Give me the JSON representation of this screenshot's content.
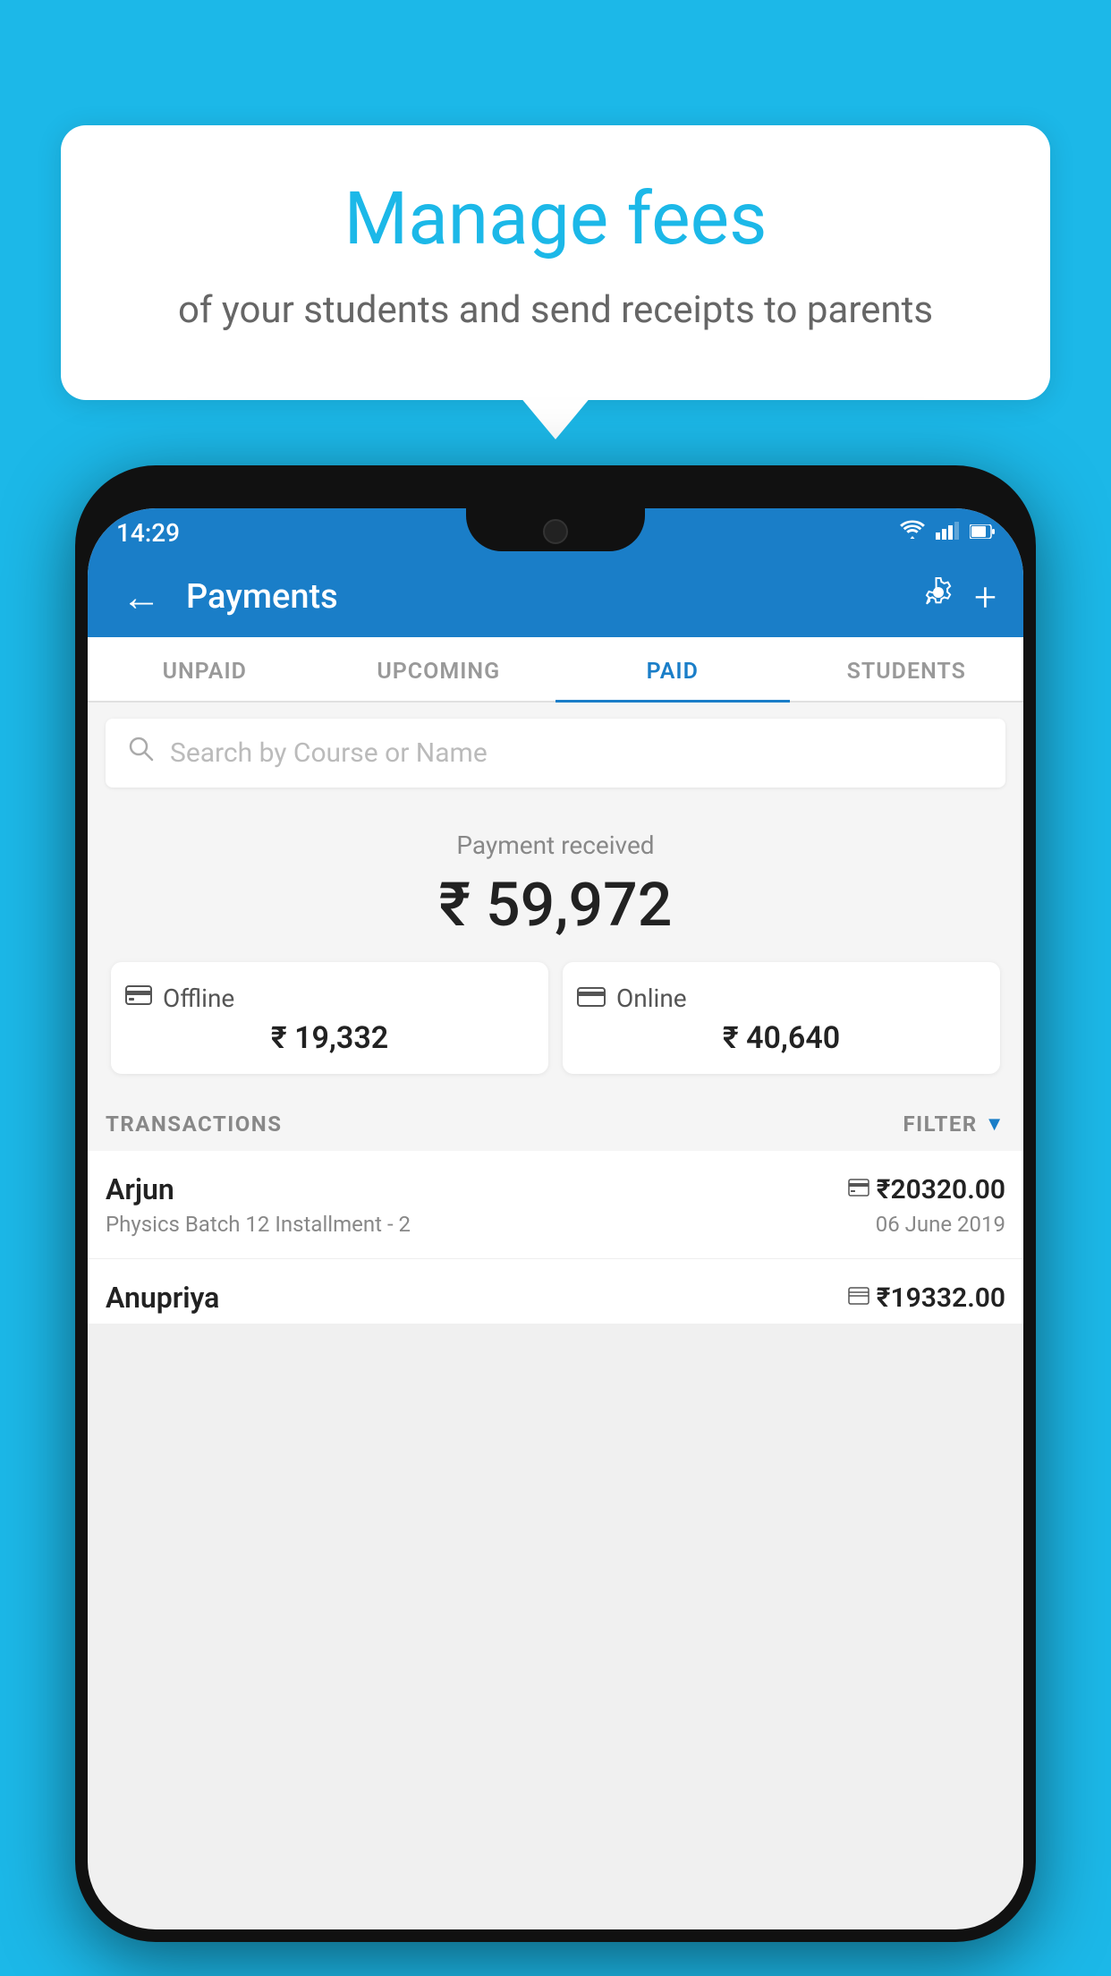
{
  "background_color": "#1cb8e8",
  "hero": {
    "title": "Manage fees",
    "subtitle": "of your students and send receipts to parents"
  },
  "status_bar": {
    "time": "14:29",
    "wifi_icon": "▲",
    "signal_icon": "▲",
    "battery_icon": "▮"
  },
  "toolbar": {
    "back_icon": "←",
    "title": "Payments",
    "gear_icon": "⚙",
    "plus_icon": "+"
  },
  "tabs": [
    {
      "label": "UNPAID",
      "active": false
    },
    {
      "label": "UPCOMING",
      "active": false
    },
    {
      "label": "PAID",
      "active": true
    },
    {
      "label": "STUDENTS",
      "active": false
    }
  ],
  "search": {
    "placeholder": "Search by Course or Name",
    "icon": "🔍"
  },
  "payment_received": {
    "label": "Payment received",
    "amount": "₹ 59,972",
    "offline": {
      "label": "Offline",
      "amount": "₹ 19,332",
      "icon": "💳"
    },
    "online": {
      "label": "Online",
      "amount": "₹ 40,640",
      "icon": "🏦"
    }
  },
  "transactions": {
    "header_label": "TRANSACTIONS",
    "filter_label": "FILTER",
    "items": [
      {
        "name": "Arjun",
        "amount": "₹20320.00",
        "amount_icon": "💳",
        "description": "Physics Batch 12 Installment - 2",
        "date": "06 June 2019"
      },
      {
        "name": "Anupriya",
        "amount": "₹19332.00",
        "amount_icon": "💵",
        "description": "",
        "date": ""
      }
    ]
  }
}
